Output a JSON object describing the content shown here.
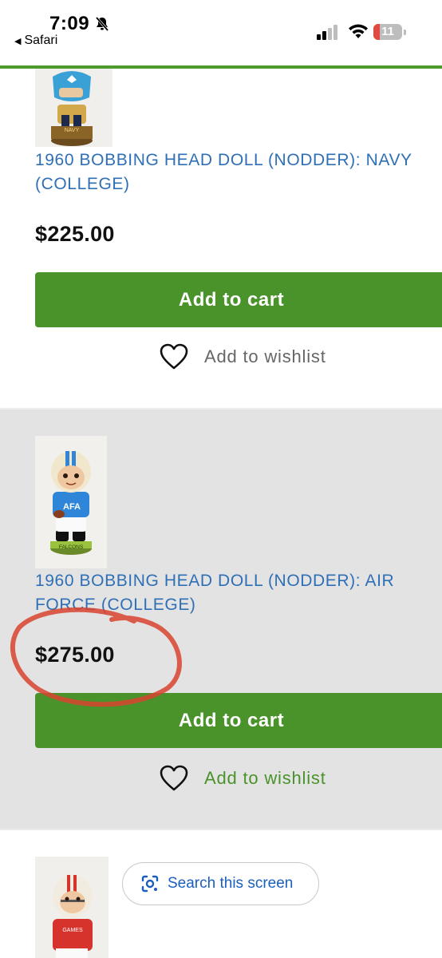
{
  "status_bar": {
    "time": "7:09",
    "back_app": "Safari",
    "battery": "11"
  },
  "products": [
    {
      "title": "1960 BOBBING HEAD DOLL (NODDER): NAVY (COLLEGE)",
      "thumb_text": "NAVY",
      "price": "$225.00",
      "cart_label": "Add to cart",
      "wishlist_label": "Add to wishlist"
    },
    {
      "title": "1960 BOBBING HEAD DOLL (NODDER): AIR FORCE (COLLEGE)",
      "thumb_text": "AFA",
      "thumb_base_text": "FALCONS",
      "price": "$275.00",
      "cart_label": "Add to cart",
      "wishlist_label": "Add to wishlist"
    },
    {
      "thumb_text": "GAMES"
    }
  ],
  "lens": {
    "label": "Search this screen"
  },
  "colors": {
    "accent_green": "#4a922a",
    "link_blue": "#2f6fb5",
    "annotation_red": "#d9432f"
  }
}
